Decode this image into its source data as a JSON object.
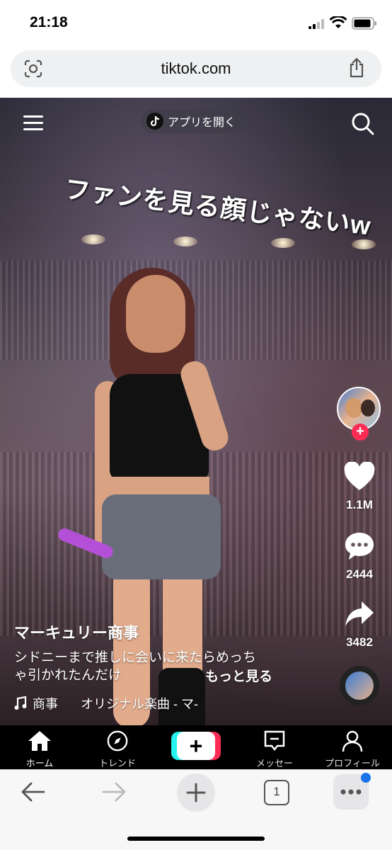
{
  "status_bar": {
    "time": "21:18"
  },
  "browser": {
    "url": "tiktok.com",
    "tab_count": "1"
  },
  "video": {
    "open_app_label": "アプリを開く",
    "caption_overlay": "ファンを見る顔じゃないw",
    "author": "マーキュリー商事",
    "description_line1": "シドニーまで推しに会いに来たらめっち",
    "description_line2": "ゃ引かれたんだけ",
    "more_label": "もっと見る",
    "music_prefix": "商事",
    "music_title": "オリジナル楽曲 - マ-"
  },
  "rail": {
    "likes": "1.1M",
    "comments": "2444",
    "shares": "3482"
  },
  "tiktok_nav": {
    "home": "ホーム",
    "trend": "トレンド",
    "message": "メッセー",
    "profile": "プロフィール"
  },
  "colors": {
    "accent_red": "#fe2c55",
    "accent_cyan": "#25f4ee",
    "notification_blue": "#1a73e8"
  },
  "icons": [
    "menu-icon",
    "search-icon",
    "tiktok-logo-icon",
    "heart-icon",
    "comment-icon",
    "share-icon",
    "music-note-icon",
    "home-icon",
    "compass-icon",
    "plus-icon",
    "message-icon",
    "profile-icon",
    "back-icon",
    "forward-icon",
    "lens-icon",
    "share-upload-icon"
  ]
}
